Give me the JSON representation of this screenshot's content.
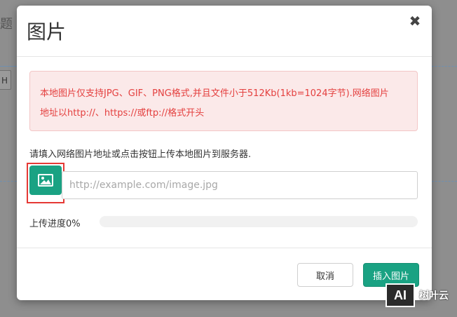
{
  "background": {
    "fragment_text": "题",
    "fragment_button": "H"
  },
  "dialog": {
    "title": "图片",
    "close_icon": "close-icon",
    "alert": {
      "line1": "本地图片仅支持JPG、GIF、PNG格式,并且文件小于512Kb(1kb=1024字节).网络图片",
      "line2": "地址以http://、https://或ftp://格式开头"
    },
    "hint": "请填入网络图片地址或点击按钮上传本地图片到服务器.",
    "upload_icon": "image-icon",
    "url_input": {
      "value": "",
      "placeholder": "http://example.com/image.jpg"
    },
    "progress": {
      "label": "上传进度0%",
      "value": 0
    },
    "buttons": {
      "cancel": "取消",
      "insert": "插入图片"
    }
  },
  "watermark": {
    "logo": "AI",
    "text": "树叶云"
  },
  "colors": {
    "primary": "#1aa283",
    "alert_bg": "#fbe9e9",
    "alert_text": "#e4403f",
    "highlight": "#e53935"
  }
}
